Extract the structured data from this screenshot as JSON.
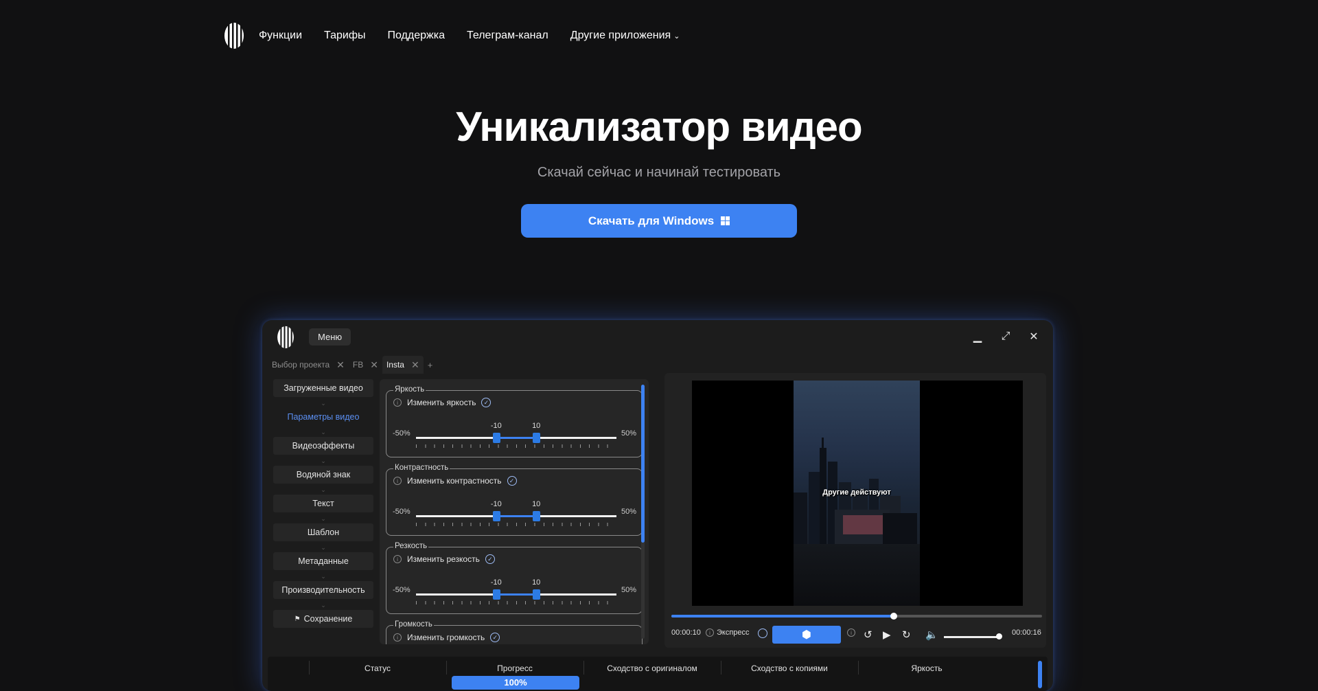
{
  "nav": {
    "items": [
      "Функции",
      "Тарифы",
      "Поддержка",
      "Телеграм-канал",
      "Другие приложения"
    ],
    "dropdown_icon": "chevron-down-icon"
  },
  "hero": {
    "title": "Уникализатор видео",
    "subtitle": "Скачай сейчас и начинай тестировать",
    "cta_label": "Скачать для Windows",
    "cta_icon": "windows-icon",
    "accent": "#3d82f2"
  },
  "app": {
    "menu_label": "Меню",
    "tabs": [
      {
        "label": "Выбор проекта"
      },
      {
        "label": "FB"
      },
      {
        "label": "Insta"
      }
    ],
    "tab_add": "+",
    "sidebar": [
      "Загруженные видео",
      "Параметры видео",
      "Видеоэффекты",
      "Водяной знак",
      "Текст",
      "Шаблон",
      "Метаданные",
      "Производительность",
      "Сохранение"
    ],
    "save_icon": "flag-icon",
    "groups": [
      {
        "title": "Яркость",
        "check_label": "Изменить яркость",
        "min": "-50%",
        "max": "50%",
        "low": "-10",
        "high": "10",
        "low_value": -10,
        "high_value": 10
      },
      {
        "title": "Контрастность",
        "check_label": "Изменить контрастность",
        "min": "-50%",
        "max": "50%",
        "low": "-10",
        "high": "10",
        "low_value": -10,
        "high_value": 10
      },
      {
        "title": "Резкость",
        "check_label": "Изменить резкость",
        "min": "-50%",
        "max": "50%",
        "low": "-10",
        "high": "10",
        "low_value": -10,
        "high_value": 10
      },
      {
        "title": "Громкость",
        "check_label": "Изменить громкость"
      }
    ],
    "player": {
      "subtitle_text": "Другие действуют",
      "time_current": "00:00:10",
      "time_total": "00:00:16",
      "express_label": "Экспресс",
      "seek_progress": 0.6
    },
    "table": {
      "headers": [
        "Статус",
        "Прогресс",
        "Сходство с оригиналом",
        "Сходство с копиями",
        "Яркость"
      ],
      "progress_value": "100%"
    }
  }
}
